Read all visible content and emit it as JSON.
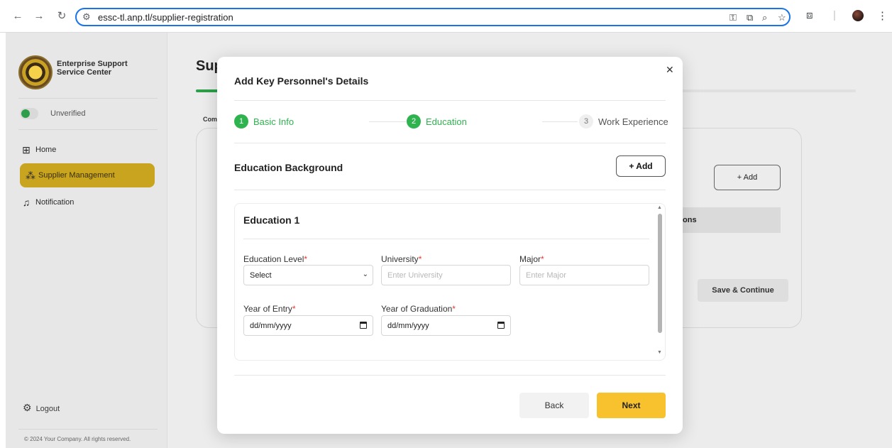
{
  "browser": {
    "url": "essc-tl.anp.tl/supplier-registration",
    "icons": [
      "back-arrow-icon",
      "forward-arrow-icon",
      "reload-icon",
      "site-settings-icon",
      "password-key-icon",
      "install-app-icon",
      "zoom-icon",
      "bookmark-star-icon",
      "extensions-icon",
      "profile-avatar",
      "more-menu-icon"
    ]
  },
  "sidebar": {
    "logo_text": "Enterprise Support Service Center",
    "status_label": "Unverified",
    "items": [
      {
        "label": "Home",
        "icon": "home-grid-icon",
        "active": false
      },
      {
        "label": "Supplier Management",
        "icon": "supplier-group-icon",
        "active": true
      },
      {
        "label": "Notification",
        "icon": "bell-icon",
        "active": false
      }
    ],
    "logout_label": "Logout",
    "copyright": "© 2024 Your Company. All rights reserved."
  },
  "background": {
    "page_title": "Sup",
    "tab_fragment": "Com",
    "add_label": "+ Add",
    "col_fragment": "ons",
    "save_label": "Save & Continue"
  },
  "modal": {
    "title": "Add Key Personnel's Details",
    "steps": [
      {
        "num": "1",
        "label": "Basic Info",
        "state": "done"
      },
      {
        "num": "2",
        "label": "Education",
        "state": "current"
      },
      {
        "num": "3",
        "label": "Work Experience",
        "state": "todo"
      }
    ],
    "section_title": "Education Background",
    "add_label": "+ Add",
    "education": {
      "title": "Education 1",
      "level_label": "Education Level",
      "level_value": "Select",
      "university_label": "University",
      "university_placeholder": "Enter University",
      "major_label": "Major",
      "major_placeholder": "Enter Major",
      "entry_label": "Year of Entry",
      "entry_value": "dd/mm/yyyy",
      "graduation_label": "Year of Graduation",
      "graduation_value": "dd/mm/yyyy",
      "required_mark": "*"
    },
    "back_label": "Back",
    "next_label": "Next"
  },
  "colors": {
    "accent_green": "#2fb34f",
    "accent_yellow": "#f8c12e",
    "required_red": "#e53935"
  }
}
